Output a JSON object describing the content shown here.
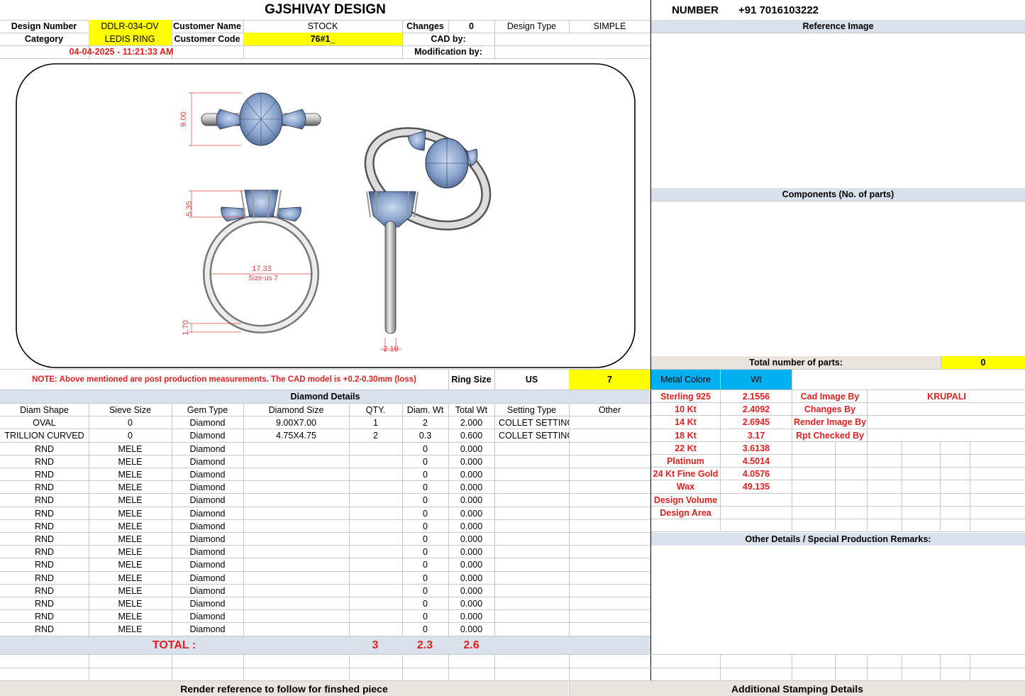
{
  "header": {
    "title": "GJSHIVAY DESIGN",
    "number_label": "NUMBER",
    "number_value": "+91 7016103222"
  },
  "info": {
    "design_number_label": "Design Number",
    "design_number": "DDLR-034-OV",
    "customer_name_label": "Customer Name",
    "customer_name": "STOCK",
    "changes_label": "Changes",
    "changes": "0",
    "design_type_label": "Design Type",
    "design_type": "SIMPLE",
    "category_label": "Category",
    "category": "LEDIS RING",
    "customer_code_label": "Customer Code",
    "customer_code": "76#1_",
    "cad_by_label": "CAD by:",
    "modification_label": "Modification by:",
    "timestamp": "04-04-2025 - 11:21:33 AM"
  },
  "drawing": {
    "dim_height": "9.00",
    "dim_top": "5.35",
    "dim_inner": "17.33",
    "size_note": "Size-us 7",
    "dim_band": "1.70",
    "dim_width": "2.10"
  },
  "right_panel": {
    "reference_image": "Reference Image",
    "components": "Components (No. of parts)",
    "total_parts_label": "Total number of parts:",
    "total_parts": "0"
  },
  "note": "NOTE: Above mentioned are post production measurements. The CAD model is +0.2-0.30mm (loss)",
  "ring_size": {
    "label": "Ring Size",
    "unit": "US",
    "value": "7"
  },
  "metal": {
    "header_color": "Metal Colore",
    "header_wt": "Wt",
    "rows": [
      {
        "name": "Sterling 925",
        "wt": "2.1556"
      },
      {
        "name": "10 Kt",
        "wt": "2.4092"
      },
      {
        "name": "14 Kt",
        "wt": "2.6945"
      },
      {
        "name": "18 Kt",
        "wt": "3.17"
      },
      {
        "name": "22 Kt",
        "wt": "3.6138"
      },
      {
        "name": "Platinum",
        "wt": "4.5014"
      },
      {
        "name": "24 Kt Fine Gold",
        "wt": "4.0576"
      },
      {
        "name": "Wax",
        "wt": "49.135"
      },
      {
        "name": "Design Volume",
        "wt": ""
      },
      {
        "name": "Design Area",
        "wt": ""
      }
    ],
    "roles": [
      {
        "label": "Cad Image By",
        "value": "KRUPALI"
      },
      {
        "label": "Changes By",
        "value": ""
      },
      {
        "label": "Render Image By",
        "value": ""
      },
      {
        "label": "Rpt Checked By",
        "value": ""
      }
    ]
  },
  "diamond": {
    "title": "Diamond Details",
    "columns": [
      "Diam Shape",
      "Sieve Size",
      "Gem Type",
      "Diamond Size",
      "QTY.",
      "Diam. Wt",
      "Total Wt",
      "Setting Type",
      "Other"
    ],
    "rows": [
      [
        "OVAL",
        "0",
        "Diamond",
        "9.00X7.00",
        "1",
        "2",
        "2.000",
        "COLLET SETTING",
        ""
      ],
      [
        "TRILLION CURVED",
        "0",
        "Diamond",
        "4.75X4.75",
        "2",
        "0.3",
        "0.600",
        "COLLET SETTING",
        ""
      ],
      [
        "RND",
        "MELE",
        "Diamond",
        "",
        "",
        "0",
        "0.000",
        "",
        ""
      ],
      [
        "RND",
        "MELE",
        "Diamond",
        "",
        "",
        "0",
        "0.000",
        "",
        ""
      ],
      [
        "RND",
        "MELE",
        "Diamond",
        "",
        "",
        "0",
        "0.000",
        "",
        ""
      ],
      [
        "RND",
        "MELE",
        "Diamond",
        "",
        "",
        "0",
        "0.000",
        "",
        ""
      ],
      [
        "RND",
        "MELE",
        "Diamond",
        "",
        "",
        "0",
        "0.000",
        "",
        ""
      ],
      [
        "RND",
        "MELE",
        "Diamond",
        "",
        "",
        "0",
        "0.000",
        "",
        ""
      ],
      [
        "RND",
        "MELE",
        "Diamond",
        "",
        "",
        "0",
        "0.000",
        "",
        ""
      ],
      [
        "RND",
        "MELE",
        "Diamond",
        "",
        "",
        "0",
        "0.000",
        "",
        ""
      ],
      [
        "RND",
        "MELE",
        "Diamond",
        "",
        "",
        "0",
        "0.000",
        "",
        ""
      ],
      [
        "RND",
        "MELE",
        "Diamond",
        "",
        "",
        "0",
        "0.000",
        "",
        ""
      ],
      [
        "RND",
        "MELE",
        "Diamond",
        "",
        "",
        "0",
        "0.000",
        "",
        ""
      ],
      [
        "RND",
        "MELE",
        "Diamond",
        "",
        "",
        "0",
        "0.000",
        "",
        ""
      ],
      [
        "RND",
        "MELE",
        "Diamond",
        "",
        "",
        "0",
        "0.000",
        "",
        ""
      ],
      [
        "RND",
        "MELE",
        "Diamond",
        "",
        "",
        "0",
        "0.000",
        "",
        ""
      ],
      [
        "RND",
        "MELE",
        "Diamond",
        "",
        "",
        "0",
        "0.000",
        "",
        ""
      ]
    ],
    "total_label": "TOTAL :",
    "total_qty": "3",
    "total_diam_wt": "2.3",
    "total_wt": "2.6"
  },
  "other_details": "Other Details / Special Production Remarks:",
  "footer": {
    "render_reference": "Render reference to follow for finshed piece",
    "stamping": "Additional Stamping Details"
  },
  "colors": {
    "highlight": "#ffff00",
    "header": "#d9e1ec",
    "metal_header": "#00b0f0",
    "red_text": "#e02020"
  }
}
